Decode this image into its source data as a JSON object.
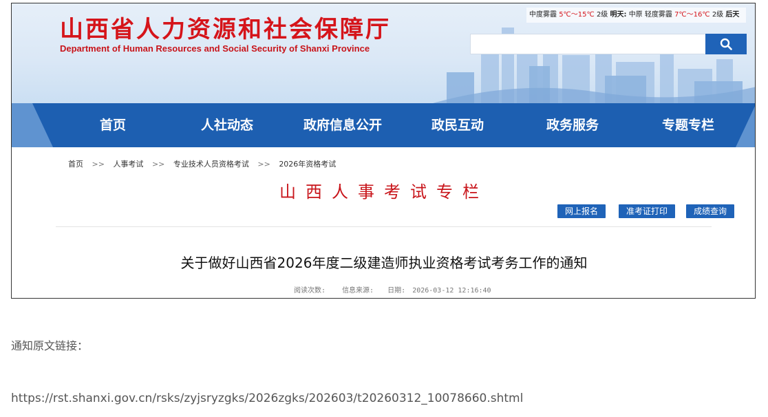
{
  "header": {
    "title": "山西省人力资源和社会保障厅",
    "subtitle": "Department of Human Resources and Social Security of Shanxi Province",
    "weather": {
      "today_weather": "中度雾霾",
      "today_temp": "5℃～15℃",
      "today_wind": "2级",
      "tomorrow_label": "明天:",
      "tomorrow_weather": "中原 轻度雾霾",
      "tomorrow_temp": "7℃～16℃",
      "tomorrow_wind": "2级",
      "after_label": "后天"
    },
    "search": {
      "placeholder": "",
      "button_icon": "search-icon"
    }
  },
  "nav": {
    "items": [
      {
        "label": "首页"
      },
      {
        "label": "人社动态"
      },
      {
        "label": "政府信息公开"
      },
      {
        "label": "政民互动"
      },
      {
        "label": "政务服务"
      },
      {
        "label": "专题专栏"
      }
    ]
  },
  "breadcrumb": {
    "separator": ">>",
    "items": [
      "首页",
      "人事考试",
      "专业技术人员资格考试",
      "2026年资格考试"
    ]
  },
  "column_title": "山西人事考试专栏",
  "actions": {
    "register": "网上报名",
    "admission": "准考证打印",
    "score": "成绩查询"
  },
  "article": {
    "title": "关于做好山西省2026年度二级建造师执业资格考试考务工作的通知",
    "views_label": "阅读次数:",
    "source_label": "信息来源:",
    "date_label": "日期:",
    "date": "2026-03-12 12:16:40"
  },
  "body": {
    "link_label": "通知原文链接：",
    "link_url": "https://rst.shanxi.gov.cn/rsks/zyjsryzgks/2026zgks/202603/t20260312_10078660.shtml"
  },
  "colors": {
    "brand_red": "#d5141a",
    "nav_blue": "#1d5fb1",
    "button_blue": "#1f63b8"
  }
}
